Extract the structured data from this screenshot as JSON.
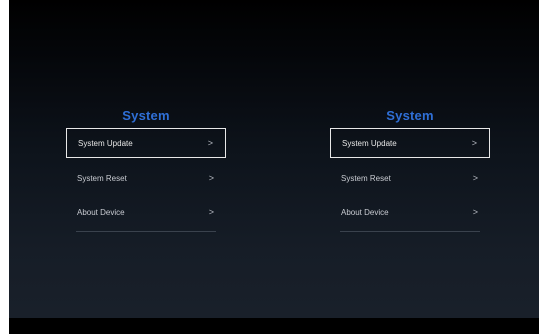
{
  "panels": [
    {
      "title": "System",
      "items": [
        {
          "label": "System Update",
          "chevron": ">"
        },
        {
          "label": "System Reset",
          "chevron": ">"
        },
        {
          "label": "About Device",
          "chevron": ">"
        }
      ],
      "selected_index": 0
    },
    {
      "title": "System",
      "items": [
        {
          "label": "System Update",
          "chevron": ">"
        },
        {
          "label": "System Reset",
          "chevron": ">"
        },
        {
          "label": "About Device",
          "chevron": ">"
        }
      ],
      "selected_index": 0
    }
  ],
  "colors": {
    "title": "#2f6fd6",
    "focus_border": "#e8e8e8",
    "item_text": "#c9ccd2"
  },
  "icons": {
    "chevron": "chevron-right-icon"
  }
}
